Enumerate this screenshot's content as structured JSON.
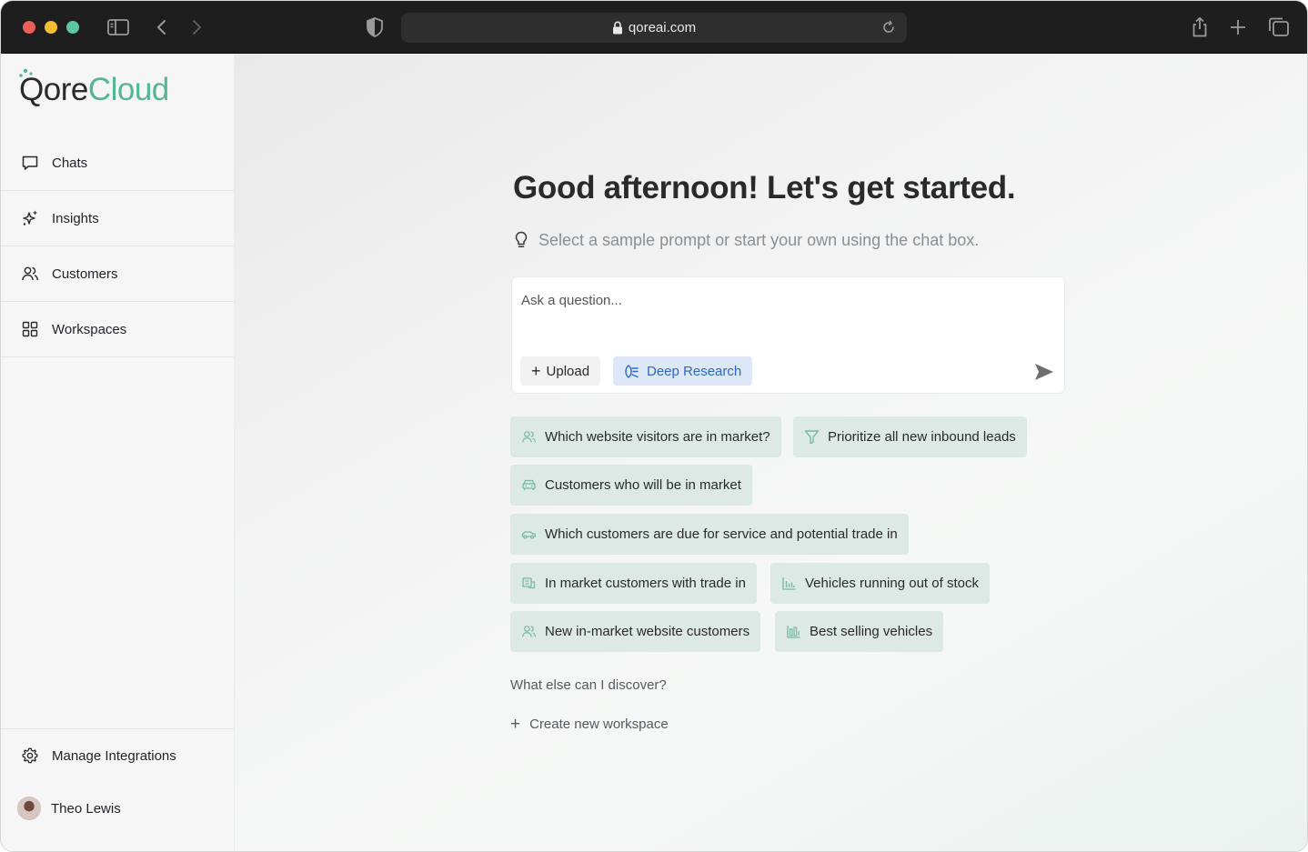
{
  "browser": {
    "url": "qoreai.com"
  },
  "brand": {
    "logo_dark": "Qore",
    "logo_accent": "Cloud",
    "accent_color": "#55b597"
  },
  "sidebar": {
    "items": [
      {
        "label": "Chats",
        "icon": "chat-bubble-icon"
      },
      {
        "label": "Insights",
        "icon": "sparkles-icon"
      },
      {
        "label": "Customers",
        "icon": "users-icon"
      },
      {
        "label": "Workspaces",
        "icon": "grid-icon"
      }
    ],
    "manage_label": "Manage Integrations",
    "user_name": "Theo Lewis"
  },
  "main": {
    "headline": "Good afternoon! Let's get started.",
    "subline": "Select a sample prompt or start your own using the chat box.",
    "chat_placeholder": "Ask a question...",
    "upload_label": "Upload",
    "deep_research_label": "Deep Research",
    "prompts": [
      {
        "label": "Which website visitors are in market?",
        "icon": "users-icon"
      },
      {
        "label": "Prioritize all new inbound leads",
        "icon": "filter-icon"
      },
      {
        "label": "Customers who will be in market",
        "icon": "car-icon"
      },
      {
        "label": "Which customers are due for service and potential trade in",
        "icon": "car-side-icon"
      },
      {
        "label": "In market customers with trade in",
        "icon": "trade-in-icon"
      },
      {
        "label": "Vehicles running out of stock",
        "icon": "bar-chart-icon"
      },
      {
        "label": "New in-market website customers",
        "icon": "users-icon"
      },
      {
        "label": "Best selling vehicles",
        "icon": "bar-chart-icon"
      }
    ],
    "discover_label": "What else can I discover?",
    "create_workspace_label": "Create new workspace"
  }
}
